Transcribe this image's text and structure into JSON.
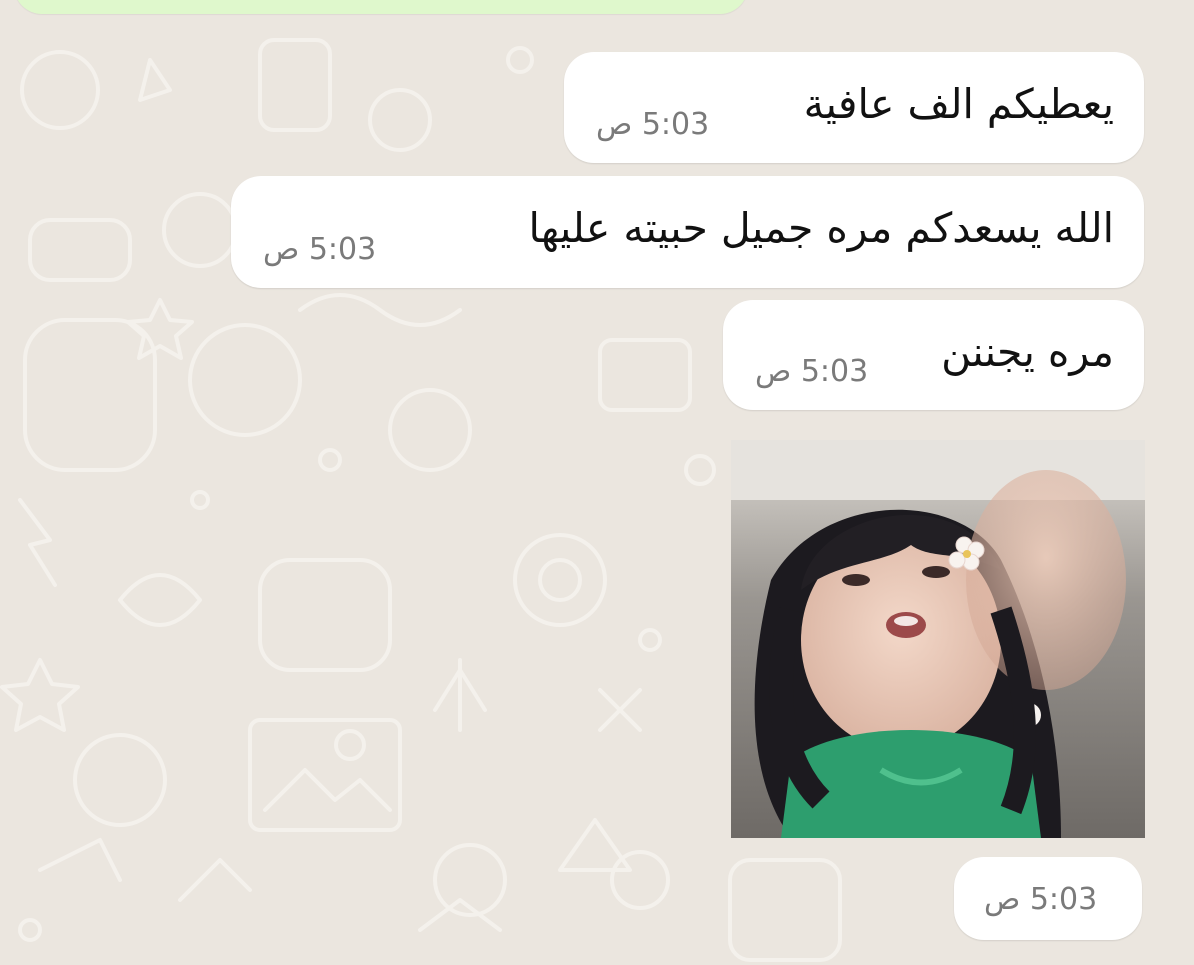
{
  "messages": [
    {
      "text": "يعطيكم الف عافية",
      "time": "5:03 ص"
    },
    {
      "text": "الله يسعدكم مره جميل حبيته عليها",
      "time": "5:03 ص"
    },
    {
      "text": "مره يجننن",
      "time": "5:03 ص"
    }
  ],
  "media_message": {
    "time": "5:03 ص"
  },
  "colors": {
    "chat_background": "#ebe6df",
    "incoming_bubble": "#ffffff",
    "outgoing_bubble": "#dff8cc",
    "timestamp": "#7a7a7a"
  }
}
